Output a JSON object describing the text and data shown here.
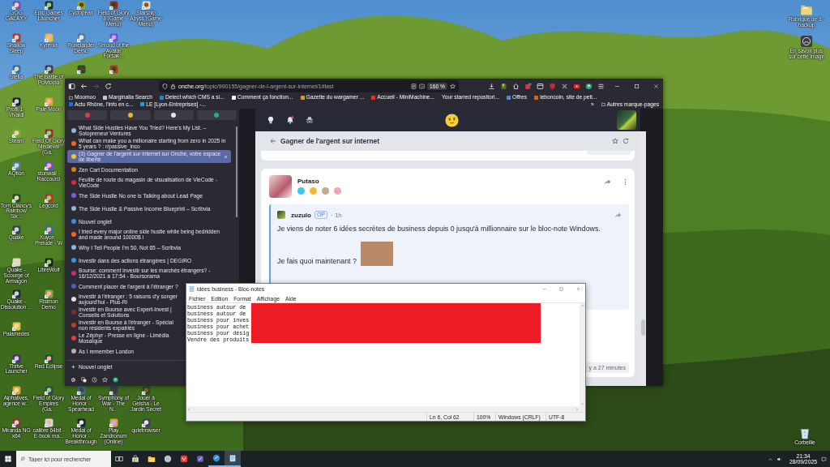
{
  "desktop": {
    "rows": [
      [
        {
          "kind": "shortcut",
          "label": "GOG GALAXY"
        },
        {
          "kind": "shortcut",
          "label": "Epic Games Launcher"
        },
        {
          "kind": "shortcut",
          "label": "Cyclopean"
        },
        {
          "kind": "shortcut",
          "label": "Field of Glory II (Game Menu)"
        },
        {
          "kind": "shortcut",
          "label": "Starship Abyss (Game Menu)"
        }
      ],
      [
        {
          "kind": "shortcut",
          "label": "Shallow Sleep"
        },
        {
          "kind": "shortcut",
          "label": "Kyrenia"
        },
        {
          "kind": "shortcut",
          "label": "Runelander Demo"
        },
        {
          "kind": "shortcut",
          "label": "Shroud of the Avatar Forsak..."
        }
      ],
      [
        {
          "kind": "shortcut",
          "label": "Stella"
        },
        {
          "kind": "shortcut",
          "label": "The Battle of Polytopia"
        },
        {
          "kind": "icon"
        },
        {
          "kind": "icon"
        }
      ],
      [
        {
          "kind": "shortcut",
          "label": "Profil 1 - Vivaldi"
        },
        {
          "kind": "shortcut",
          "label": "Pale Moon"
        }
      ],
      [
        {
          "kind": "shortcut",
          "label": "Steam"
        },
        {
          "kind": "shortcut",
          "label": "Field Of Glory Medieval (Ga..."
        }
      ],
      [
        {
          "kind": "shortcut",
          "label": "AQtion"
        },
        {
          "kind": "shortcut",
          "label": "stonwall - Raccourci"
        }
      ],
      [
        {
          "kind": "shortcut",
          "label": "Tom Clancy's Rainbow Six..."
        },
        {
          "kind": "shortcut",
          "label": "Legcord"
        }
      ],
      [
        {
          "kind": "shortcut",
          "label": "Quake"
        },
        {
          "kind": "shortcut",
          "label": "Xuyon - Prelude - W"
        }
      ],
      [
        {
          "kind": "shortcut",
          "label": "Quake - Scourge of Armagon"
        },
        {
          "kind": "shortcut",
          "label": "LibreWolf"
        }
      ],
      [
        {
          "kind": "shortcut",
          "label": "Quake - Dissolution ..."
        },
        {
          "kind": "shortcut",
          "label": "Risimon Demo"
        }
      ],
      [
        {
          "kind": "shortcut",
          "label": "Palamedes"
        }
      ],
      [
        {
          "kind": "shortcut",
          "label": "Thrive Launcher"
        },
        {
          "kind": "shortcut",
          "label": "Red Eclipse"
        }
      ],
      [
        {
          "kind": "shortcut",
          "label": "Alphalives, agence w..."
        },
        {
          "kind": "shortcut",
          "label": "Field of Glory Empires (Ga..."
        },
        {
          "kind": "shortcut",
          "label": "Medal of Honor - Spearhead"
        },
        {
          "kind": "shortcut",
          "label": "Symphony of War - The N..."
        },
        {
          "kind": "shortcut",
          "label": "Jouer à Geisha - Le Jardin Secret"
        }
      ],
      [
        {
          "kind": "shortcut",
          "label": "Miranda NG x64"
        },
        {
          "kind": "shortcut",
          "label": "calibre 64bit - E-book ma..."
        },
        {
          "kind": "shortcut",
          "label": "Medal of Honor - Breakthrough"
        },
        {
          "kind": "shortcut",
          "label": "Play Zandronum (Online)"
        },
        {
          "kind": "shortcut",
          "label": "qutebrowser"
        }
      ]
    ]
  },
  "desktop_right": {
    "top": [
      {
        "kind": "folder",
        "label": "Rubrique de 3 - backup"
      },
      {
        "kind": "camera",
        "label": "En savoir plus sur cette image"
      }
    ],
    "bottom": [
      {
        "kind": "bin",
        "label": "Corbeille"
      }
    ]
  },
  "browser": {
    "toolbar": {
      "forward_disabled": true
    },
    "url": {
      "domain": "onche.org",
      "path": "/topic/990155/gagner-de-l-argent-sur-internet/1#last",
      "zoom": "160 %"
    },
    "bookmarks": [
      {
        "kind": "folder",
        "label": "Moomoo"
      },
      {
        "kind": "link",
        "label": "Marginalia Search",
        "color": "#c8c8cc"
      },
      {
        "kind": "link",
        "label": "Detect which CMS a si...",
        "color": "#2f7fd1"
      },
      {
        "kind": "link",
        "label": "Comment ça fonction...",
        "color": "#f4f4f4"
      },
      {
        "kind": "link",
        "label": "Gazette du wargamer ...",
        "color": "#d4a017"
      },
      {
        "kind": "link",
        "label": "Accueil - MiniMachine...",
        "color": "#d63a2f"
      },
      {
        "kind": "link",
        "label": "Your starred repositori..."
      },
      {
        "kind": "link",
        "label": "Offres",
        "color": "#4a90d9"
      },
      {
        "kind": "link",
        "label": "leboncoin, site de peti...",
        "color": "#ec5a13"
      },
      {
        "kind": "link",
        "label": "Actu Rhône, l'info en c...",
        "color": "#1e6fd9"
      },
      {
        "kind": "link",
        "label": "LE [Lyon-Entreprises] -...",
        "color": "#1c9be6"
      },
      {
        "kind": "overflow",
        "label": "»"
      },
      {
        "kind": "folder",
        "label": "Autres marque-pages"
      }
    ],
    "pinned_tabs": [
      {
        "color": "#e23b4e"
      },
      {
        "color": "#f2b51c"
      },
      {
        "color": "#dfe6f0"
      },
      {
        "color": "#22b07d"
      }
    ],
    "tabs": [
      {
        "title": "What Side Hustles Have You Tried? Here's My List. – Solopreneur Ventures",
        "color": "#8ab4d8",
        "selected": false
      },
      {
        "title": "What can make you a millionaire starting from zero in 2025 in 5 years ? : r/passive_inco",
        "color": "#ff5a2b",
        "selected": false
      },
      {
        "title": "(3) Gagner de l'argent sur internet sur Onche, votre espace de liberté",
        "color": "#f4c430",
        "selected": true
      },
      {
        "title": "Zen Cart Documentation",
        "color": "#e07b22",
        "selected": false
      },
      {
        "title": "Feuille de route du magasin de visualisation de VieCode - VieCode",
        "color": "#d7263d",
        "selected": false
      },
      {
        "title": "The Side Hustle No one is Talking about Lead Page",
        "color": "#7b5ce6",
        "selected": false
      },
      {
        "title": "The Side Hustle & Passive Income Blueprint – Scribvia",
        "color": "#8ab4d8",
        "selected": false
      },
      {
        "title": "Nouvel onglet",
        "color": "#3b8ee8",
        "selected": false
      },
      {
        "title": "I tried every major online side hustle while being bedridden and made around 10000$ i",
        "color": "#ff5a2b",
        "selected": false
      },
      {
        "title": "Why I Tell People I'm 50, Not 65 – Scribvia",
        "color": "#8ab4d8",
        "selected": false
      },
      {
        "title": "Investir dans des actions étrangères | DEGIRO",
        "color": "#2d9cdb",
        "selected": false
      },
      {
        "title": "Bourse: comment investir sur les marchés étrangers? - 16/12/2021 à 17:54 - Boursorama",
        "color": "#c0306c",
        "selected": false
      },
      {
        "title": "Comment placer de l'argent à l'étranger ?",
        "color": "#4a5fc1",
        "selected": false
      },
      {
        "title": "Investir à l'étranger : 5 raisons d'y songer aujourd'hui - Plus-Ri",
        "color": "#dddddd",
        "selected": false
      },
      {
        "title": "Investir en Bourse avec Expert-Invest | Conseils et Solutions",
        "color": "#7a2e2e",
        "selected": false
      },
      {
        "title": "Investir en Bourse à l'étranger - Spécial non résidents expatriés",
        "color": "#c0392b",
        "selected": false
      },
      {
        "title": "Le Zéphyr - Presse en ligne - Limédia Mosaïque",
        "color": "#e63946",
        "selected": false
      },
      {
        "title": "As I remember London",
        "color": "#b0b0b0",
        "selected": false
      }
    ],
    "new_tab": "Nouvel onglet"
  },
  "page": {
    "has_notification": true,
    "topic_title": "Gagner de l'argent sur internet",
    "post": {
      "author": "Putaso",
      "badges": [
        {
          "color": "#3cc8e8"
        },
        {
          "color": "#f0b93a"
        },
        {
          "color": "#c9a98a"
        },
        {
          "color": "#f2a6b5"
        }
      ],
      "quote": {
        "author": "zuzulo",
        "tag": "OP",
        "time": "· 1h",
        "text": "Je viens de noter 6 idées secrètes de business depuis 0 jusqu'à millionnaire sur le bloc-note Windows.",
        "question": "Je fais quoi maintenant ?"
      }
    },
    "timestamp": "y a 27 minutes"
  },
  "notepad": {
    "title": "idées business - Bloc-notes",
    "menu": [
      "Fichier",
      "Edition",
      "Format",
      "Affichage",
      "Aide"
    ],
    "lines": [
      "business autour de",
      "business autour de",
      "business pour inves",
      "business pour achet",
      "business pour désig",
      "Vendre des produits"
    ],
    "status": [
      "Ln 6, Col 62",
      "100%",
      "Windows (CRLF)",
      "UTF-8"
    ]
  },
  "taskbar": {
    "search_placeholder": "Taper ici pour rechercher",
    "apps": [
      {
        "kind": "task_view",
        "running": false,
        "selected": false
      },
      {
        "kind": "store",
        "running": false,
        "selected": false
      },
      {
        "kind": "explorer",
        "running": false,
        "selected": false
      },
      {
        "kind": "globe",
        "running": false,
        "selected": false
      },
      {
        "kind": "vivaldi",
        "running": false,
        "selected": false
      },
      {
        "kind": "app",
        "running": false,
        "selected": false
      },
      {
        "kind": "browser",
        "running": true,
        "selected": false
      },
      {
        "kind": "notepad",
        "running": true,
        "selected": true
      }
    ],
    "time": "21:34",
    "date": "28/09/2025"
  }
}
